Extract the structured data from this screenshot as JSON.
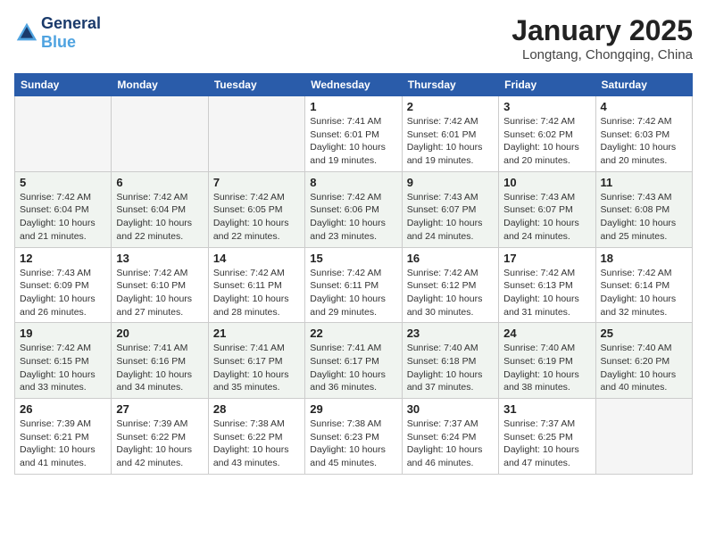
{
  "logo": {
    "line1": "General",
    "line2": "Blue"
  },
  "title": "January 2025",
  "location": "Longtang, Chongqing, China",
  "weekdays": [
    "Sunday",
    "Monday",
    "Tuesday",
    "Wednesday",
    "Thursday",
    "Friday",
    "Saturday"
  ],
  "weeks": [
    [
      {
        "day": "",
        "info": ""
      },
      {
        "day": "",
        "info": ""
      },
      {
        "day": "",
        "info": ""
      },
      {
        "day": "1",
        "info": "Sunrise: 7:41 AM\nSunset: 6:01 PM\nDaylight: 10 hours and 19 minutes."
      },
      {
        "day": "2",
        "info": "Sunrise: 7:42 AM\nSunset: 6:01 PM\nDaylight: 10 hours and 19 minutes."
      },
      {
        "day": "3",
        "info": "Sunrise: 7:42 AM\nSunset: 6:02 PM\nDaylight: 10 hours and 20 minutes."
      },
      {
        "day": "4",
        "info": "Sunrise: 7:42 AM\nSunset: 6:03 PM\nDaylight: 10 hours and 20 minutes."
      }
    ],
    [
      {
        "day": "5",
        "info": "Sunrise: 7:42 AM\nSunset: 6:04 PM\nDaylight: 10 hours and 21 minutes."
      },
      {
        "day": "6",
        "info": "Sunrise: 7:42 AM\nSunset: 6:04 PM\nDaylight: 10 hours and 22 minutes."
      },
      {
        "day": "7",
        "info": "Sunrise: 7:42 AM\nSunset: 6:05 PM\nDaylight: 10 hours and 22 minutes."
      },
      {
        "day": "8",
        "info": "Sunrise: 7:42 AM\nSunset: 6:06 PM\nDaylight: 10 hours and 23 minutes."
      },
      {
        "day": "9",
        "info": "Sunrise: 7:43 AM\nSunset: 6:07 PM\nDaylight: 10 hours and 24 minutes."
      },
      {
        "day": "10",
        "info": "Sunrise: 7:43 AM\nSunset: 6:07 PM\nDaylight: 10 hours and 24 minutes."
      },
      {
        "day": "11",
        "info": "Sunrise: 7:43 AM\nSunset: 6:08 PM\nDaylight: 10 hours and 25 minutes."
      }
    ],
    [
      {
        "day": "12",
        "info": "Sunrise: 7:43 AM\nSunset: 6:09 PM\nDaylight: 10 hours and 26 minutes."
      },
      {
        "day": "13",
        "info": "Sunrise: 7:42 AM\nSunset: 6:10 PM\nDaylight: 10 hours and 27 minutes."
      },
      {
        "day": "14",
        "info": "Sunrise: 7:42 AM\nSunset: 6:11 PM\nDaylight: 10 hours and 28 minutes."
      },
      {
        "day": "15",
        "info": "Sunrise: 7:42 AM\nSunset: 6:11 PM\nDaylight: 10 hours and 29 minutes."
      },
      {
        "day": "16",
        "info": "Sunrise: 7:42 AM\nSunset: 6:12 PM\nDaylight: 10 hours and 30 minutes."
      },
      {
        "day": "17",
        "info": "Sunrise: 7:42 AM\nSunset: 6:13 PM\nDaylight: 10 hours and 31 minutes."
      },
      {
        "day": "18",
        "info": "Sunrise: 7:42 AM\nSunset: 6:14 PM\nDaylight: 10 hours and 32 minutes."
      }
    ],
    [
      {
        "day": "19",
        "info": "Sunrise: 7:42 AM\nSunset: 6:15 PM\nDaylight: 10 hours and 33 minutes."
      },
      {
        "day": "20",
        "info": "Sunrise: 7:41 AM\nSunset: 6:16 PM\nDaylight: 10 hours and 34 minutes."
      },
      {
        "day": "21",
        "info": "Sunrise: 7:41 AM\nSunset: 6:17 PM\nDaylight: 10 hours and 35 minutes."
      },
      {
        "day": "22",
        "info": "Sunrise: 7:41 AM\nSunset: 6:17 PM\nDaylight: 10 hours and 36 minutes."
      },
      {
        "day": "23",
        "info": "Sunrise: 7:40 AM\nSunset: 6:18 PM\nDaylight: 10 hours and 37 minutes."
      },
      {
        "day": "24",
        "info": "Sunrise: 7:40 AM\nSunset: 6:19 PM\nDaylight: 10 hours and 38 minutes."
      },
      {
        "day": "25",
        "info": "Sunrise: 7:40 AM\nSunset: 6:20 PM\nDaylight: 10 hours and 40 minutes."
      }
    ],
    [
      {
        "day": "26",
        "info": "Sunrise: 7:39 AM\nSunset: 6:21 PM\nDaylight: 10 hours and 41 minutes."
      },
      {
        "day": "27",
        "info": "Sunrise: 7:39 AM\nSunset: 6:22 PM\nDaylight: 10 hours and 42 minutes."
      },
      {
        "day": "28",
        "info": "Sunrise: 7:38 AM\nSunset: 6:22 PM\nDaylight: 10 hours and 43 minutes."
      },
      {
        "day": "29",
        "info": "Sunrise: 7:38 AM\nSunset: 6:23 PM\nDaylight: 10 hours and 45 minutes."
      },
      {
        "day": "30",
        "info": "Sunrise: 7:37 AM\nSunset: 6:24 PM\nDaylight: 10 hours and 46 minutes."
      },
      {
        "day": "31",
        "info": "Sunrise: 7:37 AM\nSunset: 6:25 PM\nDaylight: 10 hours and 47 minutes."
      },
      {
        "day": "",
        "info": ""
      }
    ]
  ]
}
